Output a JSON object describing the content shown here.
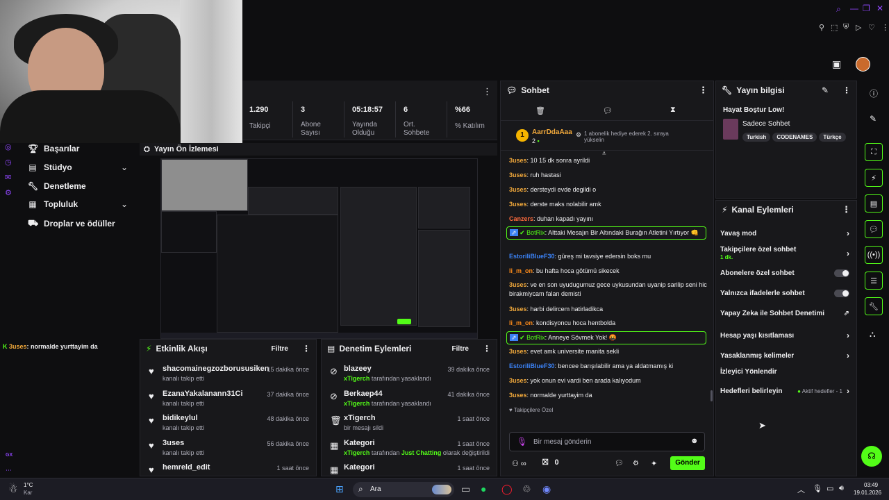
{
  "stats": [
    {
      "value": "1.290",
      "label": "Takipçi"
    },
    {
      "value": "3",
      "label": "Abone Sayısı"
    },
    {
      "value": "05:18:57",
      "label": "Yayında Olduğu"
    },
    {
      "value": "6",
      "label": "Ort. Sohbete"
    },
    {
      "value": "%66",
      "label": "% Katılım"
    }
  ],
  "nav": {
    "items": [
      {
        "label": "Başarılar"
      },
      {
        "label": "Stüdyo"
      },
      {
        "label": "Denetleme"
      },
      {
        "label": "Topluluk"
      },
      {
        "label": "Droplar ve ödüller"
      }
    ]
  },
  "preview": {
    "title": "Yayın Ön İzlemesi"
  },
  "left_ticker": {
    "user": "3uses",
    "text": ": normalde yurttayim da"
  },
  "left_small": {
    "a": "GX"
  },
  "activity": {
    "title": "Etkinlik Akışı",
    "filter": "Filtre",
    "rows": [
      {
        "name": "shacomainegzozborususiken",
        "sub": "kanalı takip etti",
        "time": "15 dakika önce"
      },
      {
        "name": "EzanaYakalanann31Ci",
        "sub": "kanalı takip etti",
        "time": "37 dakika önce"
      },
      {
        "name": "bidikeylul",
        "sub": "kanalı takip etti",
        "time": "48 dakika önce"
      },
      {
        "name": "3uses",
        "sub": "kanalı takip etti",
        "time": "56 dakika önce"
      },
      {
        "name": "hemreld_edit",
        "sub": "",
        "time": "1 saat önce"
      }
    ]
  },
  "moderation": {
    "title": "Denetim Eylemleri",
    "filter": "Filtre",
    "rows": [
      {
        "name": "blazeey",
        "by": "xTigerch",
        "sub": " tarafından yasaklandı",
        "time": "39 dakika önce"
      },
      {
        "name": "Berkaep44",
        "by": "xTigerch",
        "sub": " tarafından yasaklandı",
        "time": "41 dakika önce"
      },
      {
        "name": "xTigerch",
        "by": "",
        "sub": "bir mesajı sildi",
        "time": "1 saat önce"
      },
      {
        "name": "Kategori",
        "by": "xTigerch",
        "sub": " tarafından ",
        "extra": "Just Chatting",
        "sub2": " olarak değiştirildi",
        "time": "1 saat önce"
      },
      {
        "name": "Kategori",
        "by": "",
        "sub": "",
        "time": "1 saat önce"
      }
    ]
  },
  "chat": {
    "title": "Sohbet",
    "gifter": {
      "rank": "1",
      "name": "AarrDdaAaa",
      "count": "2",
      "note": "1 abonelik hediye ederek 2. sıraya yükselin"
    },
    "messages": [
      {
        "user": "3uses",
        "color": "#f2a93b",
        "text": "10 15 dk sonra ayrildi"
      },
      {
        "user": "3uses",
        "color": "#f2a93b",
        "text": "ruh hastasi"
      },
      {
        "user": "3uses",
        "color": "#f2a93b",
        "text": "dersteydi evde degildi o"
      },
      {
        "user": "3uses",
        "color": "#f2a93b",
        "text": "derste maks nolabilir amk"
      },
      {
        "user": "Canzers",
        "color": "#ff6b3d",
        "text": "duhan kapadı yayını"
      },
      {
        "user": "BotRix",
        "color": "#53fc18",
        "text": "Alttaki Mesajın Bir Altındaki Burağın Atletini Yırtıyor 👊",
        "bot": true
      },
      {
        "user": "EstoriliBlueF30",
        "color": "#3b82f6",
        "text": "güreş mi tavsiye edersin boks mu"
      },
      {
        "user": "li_m_on",
        "color": "#ff8c1a",
        "text": "bu hafta hoca götümü sikecek"
      },
      {
        "user": "3uses",
        "color": "#f2a93b",
        "text": "ve en son uyudugumuz gece uykusundan uyanip sarilip seni hic birakmiycam falan demisti"
      },
      {
        "user": "3uses",
        "color": "#f2a93b",
        "text": "harbi delircem hatirladikca"
      },
      {
        "user": "li_m_on",
        "color": "#ff8c1a",
        "text": "kondisyoncu hoca hentbolda"
      },
      {
        "user": "BotRix",
        "color": "#53fc18",
        "text": "Anneye Sövmek Yok! 🤬",
        "bot": true
      },
      {
        "user": "3uses",
        "color": "#f2a93b",
        "text": "evet amk universite manita sekli"
      },
      {
        "user": "EstoriliBlueF30",
        "color": "#3b82f6",
        "text": "bencee barışılabilir ama ya aldatmamış ki"
      },
      {
        "user": "3uses",
        "color": "#f2a93b",
        "text": "yok onun evi vardi ben arada kalıyodum"
      },
      {
        "user": "3uses",
        "color": "#f2a93b",
        "text": "normalde yurttayim da"
      }
    ],
    "followers_only": "Takipçilere Özel",
    "input_placeholder": "Bir mesaj gönderin",
    "points": "0",
    "send": "Gönder"
  },
  "info": {
    "title": "Yayın bilgisi",
    "stream_title": "Hayat Boştur Low!",
    "category": "Sadece Sohbet",
    "tags": [
      "Turkish",
      "CODENAMES",
      "Türkçe"
    ]
  },
  "actions": {
    "title": "Kanal Eylemleri",
    "items": [
      {
        "label": "Yavaş mod"
      },
      {
        "label": "Takipçilere özel sohbet",
        "sub": "1 dk."
      },
      {
        "label": "Abonelere özel sohbet"
      },
      {
        "label": "Yalnızca ifadelerle sohbet"
      },
      {
        "label": "Yapay Zeka ile Sohbet Denetimi"
      },
      {
        "label": "Hesap yaşı kısıtlaması"
      },
      {
        "label": "Yasaklanmış kelimeler"
      },
      {
        "label": "İzleyici Yönlendir"
      },
      {
        "label": "Hedefleri belirleyin",
        "badge": "Aktif hedefler - 1"
      }
    ]
  },
  "taskbar": {
    "weather_temp": "1°C",
    "weather_desc": "Kar",
    "search": "Ara",
    "time": "03:49",
    "date": "19.01.2026"
  },
  "colors": {
    "accent": "#53fc18",
    "purple": "#9147ff",
    "bg": "#0e0e10",
    "panel": "#18181b"
  }
}
